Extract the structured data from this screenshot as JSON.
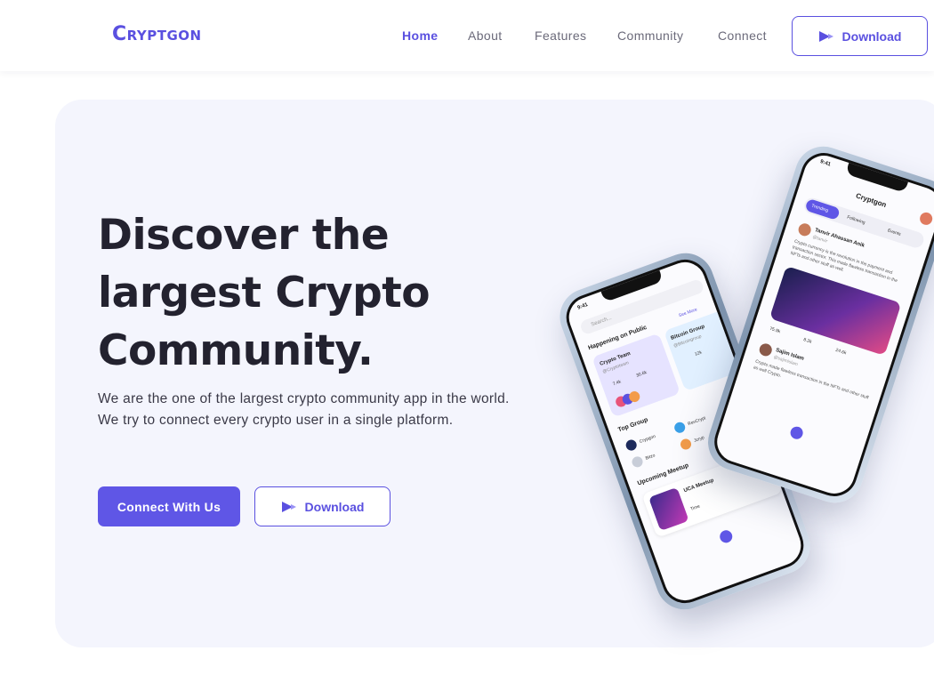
{
  "header": {
    "logo": "Cryptgon",
    "nav": [
      {
        "label": "Home",
        "active": true
      },
      {
        "label": "About",
        "active": false
      },
      {
        "label": "Features",
        "active": false
      },
      {
        "label": "Community",
        "active": false
      },
      {
        "label": "Connect",
        "active": false
      }
    ],
    "download_label": "Download"
  },
  "hero": {
    "title_line1": "Discover the",
    "title_line2": "largest Crypto",
    "title_line3": "Community.",
    "description": "We are the one of the largest crypto community app in the world. We try to connect every crypto user in a single platform.",
    "primary_button": "Connect With Us",
    "secondary_button": "Download"
  },
  "phone_back": {
    "time": "9:41",
    "search_placeholder": "Search...",
    "section_public": "Happening on Public",
    "see_more": "See More",
    "card1_title": "Crypto Team",
    "card1_handle": "@Cryptoteam",
    "card1_stat1": "7.4k",
    "card1_stat2": "30.6k",
    "card2_title": "Bitcoin Group",
    "card2_handle": "@Bitcoingroup",
    "card2_stat1": "12k",
    "section_top": "Top Group",
    "group1": "Crypgon",
    "group2": "RevCrypt",
    "group3": "Bitzo",
    "group4": "Jcryp",
    "section_meetup": "Upcoming Meetup",
    "meetup_title": "UCA Meetup",
    "meetup_time": "Time"
  },
  "phone_front": {
    "time": "9:41",
    "title": "Cryptgon",
    "tab1": "Trending",
    "tab2": "Following",
    "tab3": "Events",
    "post1_author": "Tanvir Ahassan Anik",
    "post1_handle": "@tanvir",
    "post1_text": "Crypto currency is the revolution in the payment and transaction sector. This made flawless transaction in the NFTs and other stuff as well.",
    "post1_likes": "75.9k",
    "post1_comments": "8.2k",
    "post1_shares": "24.6k",
    "post2_author": "Sajim Islam",
    "post2_handle": "@sajimislam",
    "post2_text": "Crypto made flawless transaction in the NFTs and other stuff as well Crypto."
  },
  "colors": {
    "accent": "#5a50e0",
    "hero_bg": "#f4f5fd",
    "title": "#23222f"
  }
}
